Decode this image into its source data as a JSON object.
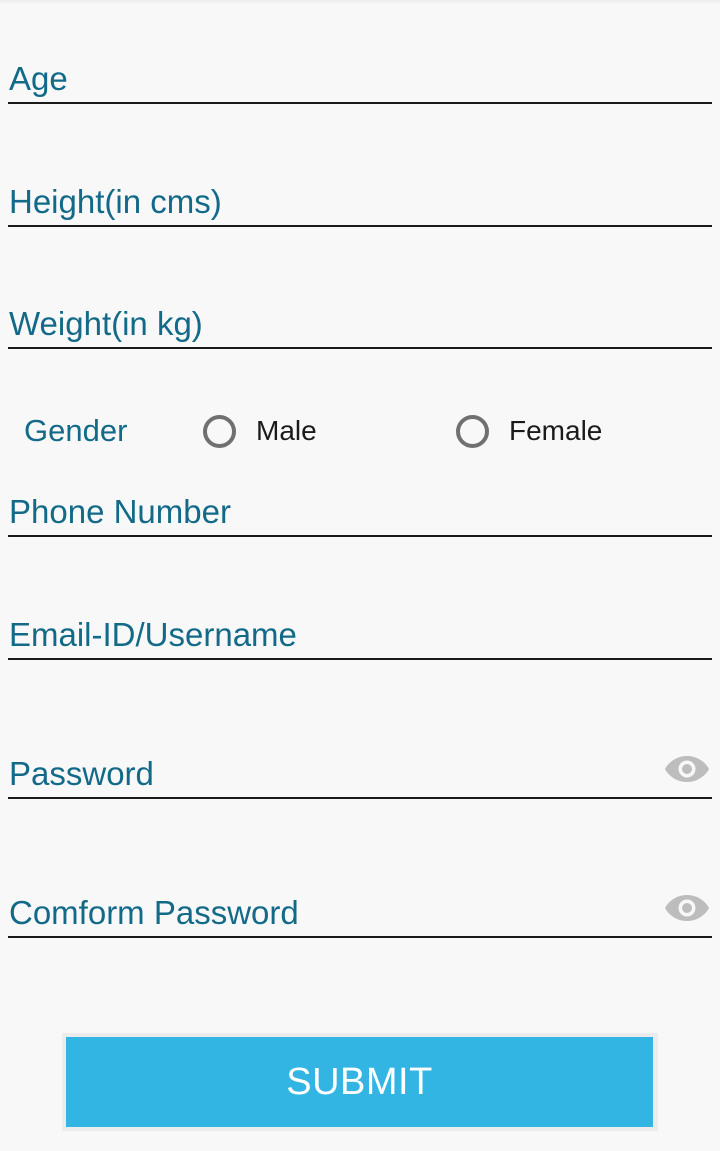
{
  "form": {
    "age": {
      "placeholder": "Age"
    },
    "height": {
      "placeholder": "Height(in cms)"
    },
    "weight": {
      "placeholder": "Weight(in kg)"
    },
    "gender": {
      "label": "Gender",
      "options": [
        {
          "label": "Male",
          "selected": false
        },
        {
          "label": "Female",
          "selected": false
        }
      ]
    },
    "phone": {
      "placeholder": "Phone Number"
    },
    "email": {
      "placeholder": "Email-ID/Username"
    },
    "password": {
      "placeholder": "Password",
      "toggle_icon": "eye-icon"
    },
    "confirm_password": {
      "placeholder": "Comform Password",
      "toggle_icon": "eye-icon"
    },
    "submit_label": "SUBMIT"
  },
  "colors": {
    "hint_text": "#136a88",
    "underline": "#1a1a1a",
    "submit_bg": "#33b5e4",
    "submit_text": "#ffffff",
    "radio_ring": "#707070",
    "eye_icon": "#bdbdbd",
    "background": "#f8f8f8"
  }
}
